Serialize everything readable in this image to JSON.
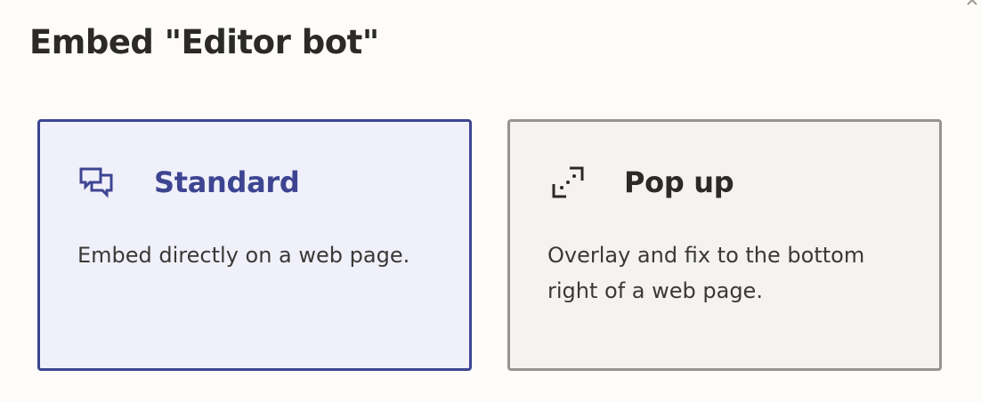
{
  "dialog": {
    "title": "Embed \"Editor bot\""
  },
  "options": [
    {
      "id": "standard",
      "label": "Standard",
      "description": "Embed directly on a web page.",
      "icon": "chat-bubbles-icon",
      "selected": true
    },
    {
      "id": "popup",
      "label": "Pop up",
      "description": "Overlay and fix to the bottom right of a web page.",
      "icon": "popup-expand-icon",
      "selected": false
    }
  ],
  "colors": {
    "selected_border": "#3d4592",
    "selected_background": "#f0f0fa",
    "unselected_border": "#95948f",
    "unselected_background": "#f4f3f0",
    "page_background": "#fdfcf9"
  }
}
